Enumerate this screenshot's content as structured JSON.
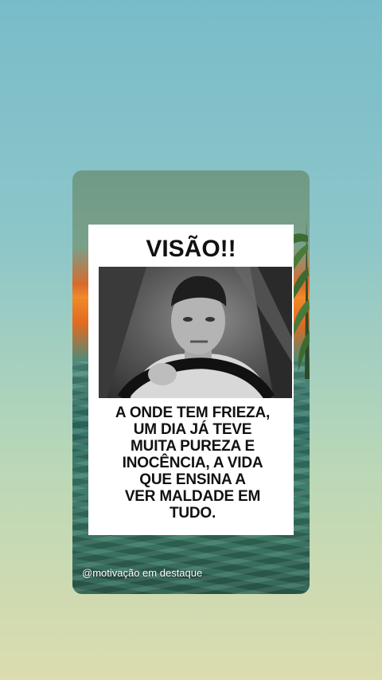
{
  "post": {
    "title": "VISÃO!!",
    "quote_lines": [
      "A ONDE TEM FRIEZA,",
      "UM DIA JÁ TEVE",
      "MUITA PUREZA E",
      "INOCÊNCIA, A VIDA",
      "QUE ENSINA A",
      "VER MALDADE EM",
      "TUDO."
    ],
    "watermark": "@motivação em destaque"
  },
  "colors": {
    "background_top": "#79bcc9",
    "background_bottom": "#dcdcae",
    "sunset": "#f08a2a",
    "sea": "#2f6e64"
  }
}
